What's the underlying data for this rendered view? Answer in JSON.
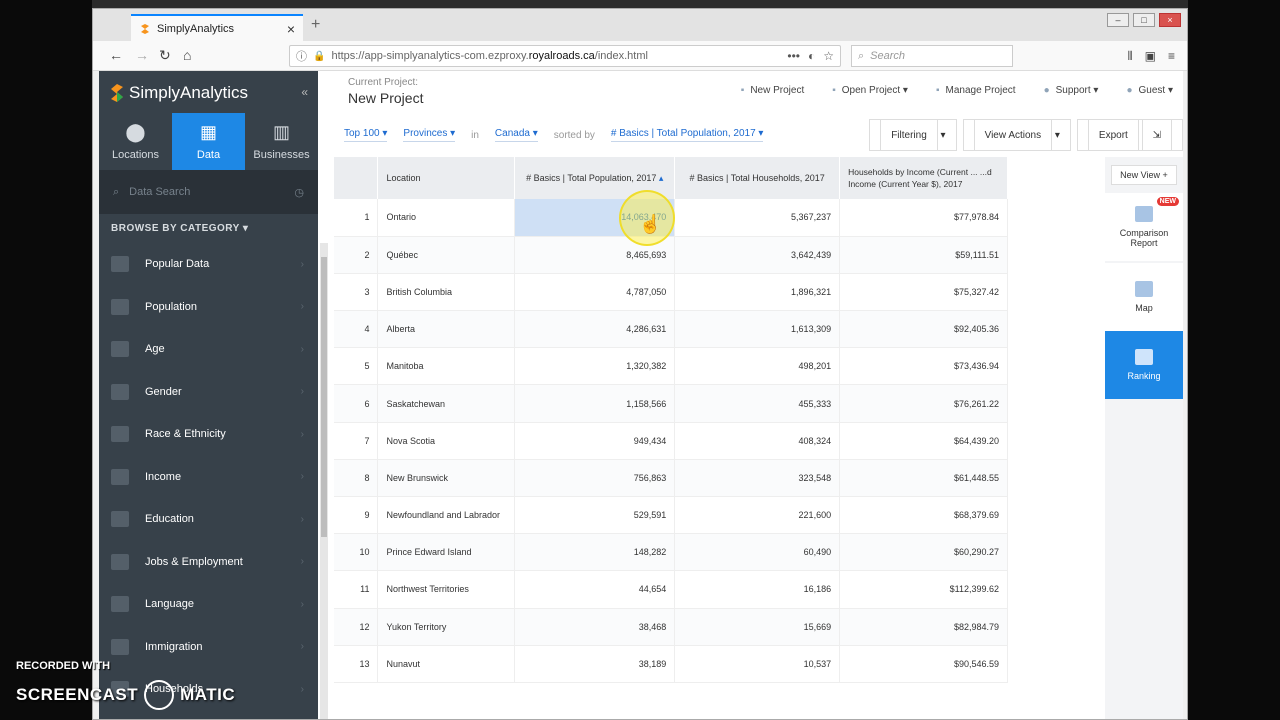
{
  "browser": {
    "tab_title": "SimplyAnalytics",
    "url_prefix": "https://app-simplyanalytics-com.ezproxy.",
    "url_domain": "royalroads.ca",
    "url_suffix": "/index.html",
    "search_placeholder": "Search"
  },
  "sidebar": {
    "brand": "SimplyAnalytics",
    "modes": [
      {
        "label": "Locations",
        "icon": "map-pin-icon"
      },
      {
        "label": "Data",
        "icon": "grid-icon"
      },
      {
        "label": "Businesses",
        "icon": "building-icon"
      }
    ],
    "search_placeholder": "Data Search",
    "browse_label": "BROWSE BY CATEGORY",
    "categories": [
      "Popular Data",
      "Population",
      "Age",
      "Gender",
      "Race & Ethnicity",
      "Income",
      "Education",
      "Jobs & Employment",
      "Language",
      "Immigration",
      "Households"
    ]
  },
  "project": {
    "label": "Current Project:",
    "name": "New Project"
  },
  "topnav": {
    "new_project": "New Project",
    "open_project": "Open Project",
    "manage_project": "Manage Project",
    "support": "Support",
    "guest": "Guest"
  },
  "filter": {
    "top": "Top 100",
    "level": "Provinces",
    "in": "in",
    "region": "Canada",
    "sorted_by": "sorted by",
    "sort_var": "# Basics | Total Population, 2017"
  },
  "actions": {
    "filtering": "Filtering",
    "view_actions": "View Actions",
    "export": "Export"
  },
  "table": {
    "headers": [
      "Location",
      "# Basics | Total Population, 2017",
      "# Basics | Total Households, 2017",
      "Households by Income (Current ... ...d Income (Current Year $), 2017"
    ],
    "rows": [
      {
        "idx": "1",
        "loc": "Ontario",
        "pop": "14,063,470",
        "hh": "5,367,237",
        "inc": "$77,978.84"
      },
      {
        "idx": "2",
        "loc": "Québec",
        "pop": "8,465,693",
        "hh": "3,642,439",
        "inc": "$59,111.51"
      },
      {
        "idx": "3",
        "loc": "British Columbia",
        "pop": "4,787,050",
        "hh": "1,896,321",
        "inc": "$75,327.42"
      },
      {
        "idx": "4",
        "loc": "Alberta",
        "pop": "4,286,631",
        "hh": "1,613,309",
        "inc": "$92,405.36"
      },
      {
        "idx": "5",
        "loc": "Manitoba",
        "pop": "1,320,382",
        "hh": "498,201",
        "inc": "$73,436.94"
      },
      {
        "idx": "6",
        "loc": "Saskatchewan",
        "pop": "1,158,566",
        "hh": "455,333",
        "inc": "$76,261.22"
      },
      {
        "idx": "7",
        "loc": "Nova Scotia",
        "pop": "949,434",
        "hh": "408,324",
        "inc": "$64,439.20"
      },
      {
        "idx": "8",
        "loc": "New Brunswick",
        "pop": "756,863",
        "hh": "323,548",
        "inc": "$61,448.55"
      },
      {
        "idx": "9",
        "loc": "Newfoundland and Labrador",
        "pop": "529,591",
        "hh": "221,600",
        "inc": "$68,379.69"
      },
      {
        "idx": "10",
        "loc": "Prince Edward Island",
        "pop": "148,282",
        "hh": "60,490",
        "inc": "$60,290.27"
      },
      {
        "idx": "11",
        "loc": "Northwest Territories",
        "pop": "44,654",
        "hh": "16,186",
        "inc": "$112,399.62"
      },
      {
        "idx": "12",
        "loc": "Yukon Territory",
        "pop": "38,468",
        "hh": "15,669",
        "inc": "$82,984.79"
      },
      {
        "idx": "13",
        "loc": "Nunavut",
        "pop": "38,189",
        "hh": "10,537",
        "inc": "$90,546.59"
      }
    ]
  },
  "views": {
    "new_view": "New View",
    "badge": "NEW",
    "items": [
      "Comparison Report",
      "Map",
      "Ranking"
    ]
  },
  "watermark": {
    "recorded": "RECORDED WITH",
    "brand_left": "SCREENCAST",
    "brand_right": "MATIC"
  }
}
